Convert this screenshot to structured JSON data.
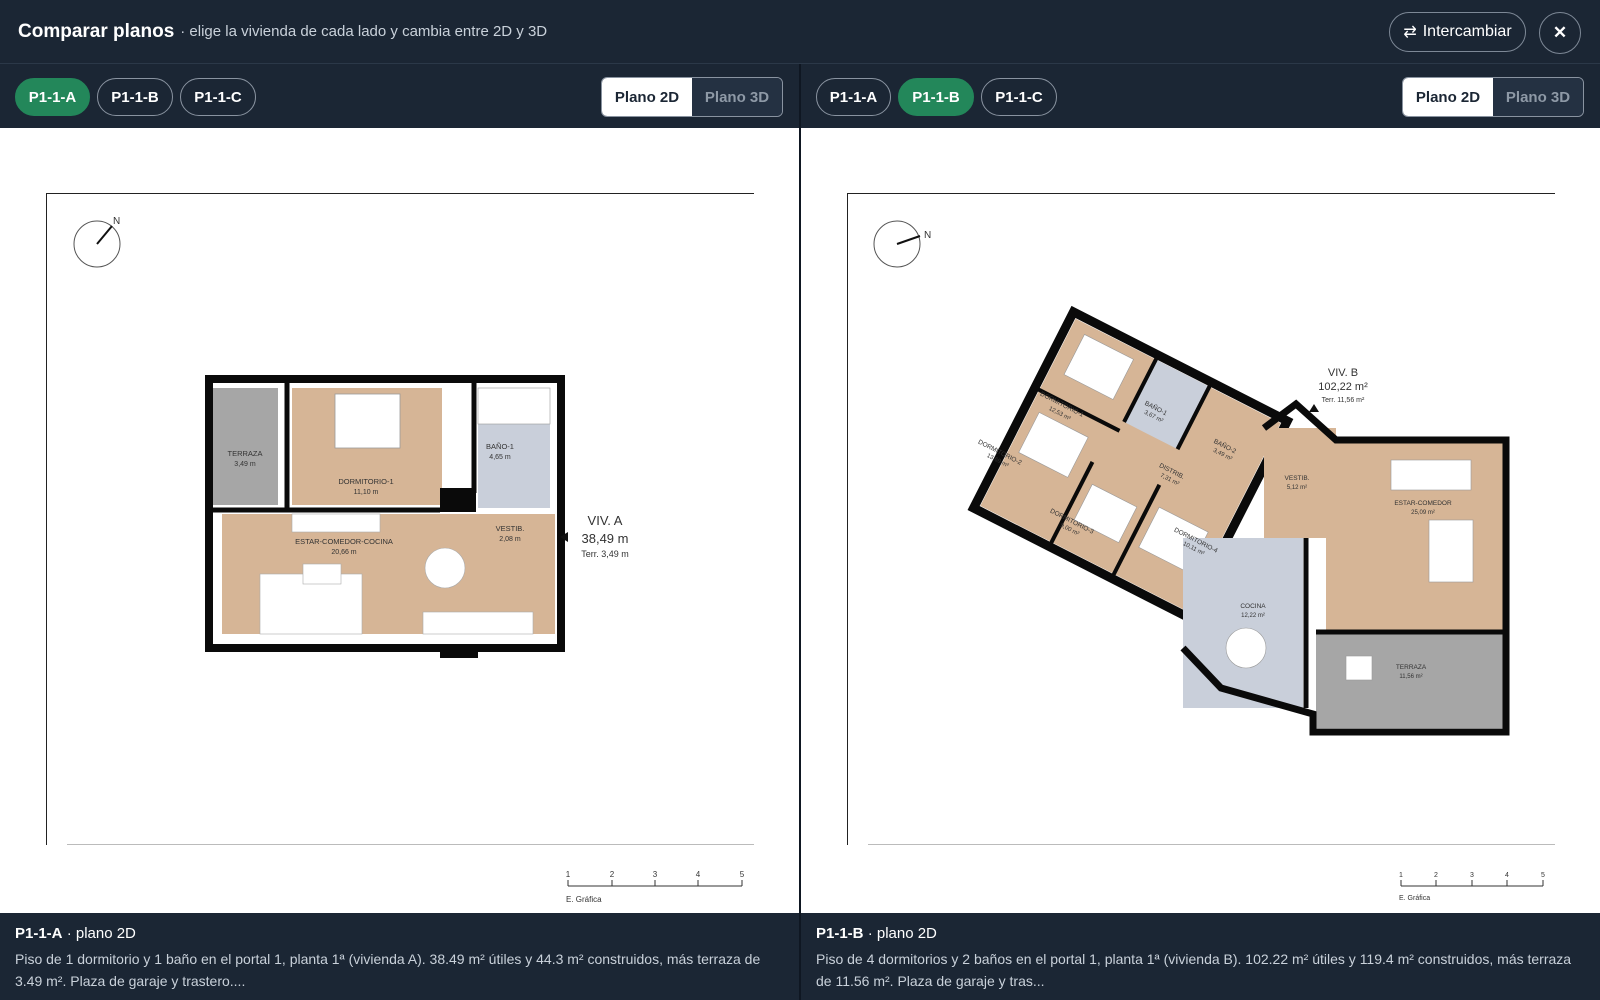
{
  "header": {
    "title": "Comparar planos",
    "subtitle": "· elige la vivienda de cada lado y cambia entre 2D y 3D",
    "swap_icon": "⇄",
    "swap_label": "Intercambiar",
    "close_icon": "✕"
  },
  "left": {
    "tabs": [
      "P1-1-A",
      "P1-1-B",
      "P1-1-C"
    ],
    "active_tab": "P1-1-A",
    "view_2d": "Plano 2D",
    "view_3d": "Plano 3D",
    "active_view": "Plano 2D",
    "plan": {
      "north": "N",
      "unit_label": "VIV. A",
      "unit_area": "38,49 m",
      "terrace": "Terr. 3,49 m",
      "rooms": [
        {
          "name": "TERRAZA",
          "area": "3,49 m"
        },
        {
          "name": "DORMITORIO-1",
          "area": "11,10 m"
        },
        {
          "name": "BAÑO-1",
          "area": "4,65 m"
        },
        {
          "name": "ESTAR-COMEDOR-COCINA",
          "area": "20,66 m"
        },
        {
          "name": "VESTIB.",
          "area": "2,08 m"
        }
      ],
      "scale": {
        "ticks": [
          "1",
          "2",
          "3",
          "4",
          "5"
        ],
        "label": "E. Gráfica"
      }
    },
    "info": {
      "code": "P1-1-A",
      "view": "· plano 2D",
      "description": "Piso de 1 dormitorio y 1 baño en el portal 1, planta 1ª (vivienda A). 38.49 m² útiles y 44.3 m² construidos, más terraza de 3.49 m². Plaza de garaje y trastero...."
    }
  },
  "right": {
    "tabs": [
      "P1-1-A",
      "P1-1-B",
      "P1-1-C"
    ],
    "active_tab": "P1-1-B",
    "view_2d": "Plano 2D",
    "view_3d": "Plano 3D",
    "active_view": "Plano 2D",
    "plan": {
      "north": "N",
      "unit_label": "VIV. B",
      "unit_area": "102,22 m²",
      "terrace": "Terr. 11,56 m²",
      "rooms": [
        {
          "name": "DORMITORIO-1",
          "area": "12,53 m²"
        },
        {
          "name": "BAÑO-1",
          "area": "3,67 m²"
        },
        {
          "name": "BAÑO-2",
          "area": "3,49 m²"
        },
        {
          "name": "DORMITORIO-2",
          "area": "13,69 m²"
        },
        {
          "name": "DISTRIB.",
          "area": "7,31 m²"
        },
        {
          "name": "VESTIB.",
          "area": "5,12 m²"
        },
        {
          "name": "ESTAR-COMEDOR",
          "area": "25,09 m²"
        },
        {
          "name": "DORMITORIO-3",
          "area": "9,00 m²"
        },
        {
          "name": "DORMITORIO-4",
          "area": "10,11 m²"
        },
        {
          "name": "COCINA",
          "area": "12,22 m²"
        },
        {
          "name": "TERRAZA",
          "area": "11,56 m²"
        }
      ],
      "scale": {
        "ticks": [
          "1",
          "2",
          "3",
          "4",
          "5"
        ],
        "label": "E. Gráfica"
      }
    },
    "info": {
      "code": "P1-1-B",
      "view": "· plano 2D",
      "description": "Piso de 4 dormitorios y 2 baños en el portal 1, planta 1ª (vivienda B). 102.22 m² útiles y 119.4 m² construidos, más terraza de 11.56 m². Plaza de garaje y tras..."
    }
  },
  "colors": {
    "background": "#1b2634",
    "active_tab": "#23875a",
    "wood_floor": "#d6b596",
    "tile_floor": "#c9cfda",
    "terrace_floor": "#a6a6a6",
    "wall": "#0a0a0a"
  }
}
